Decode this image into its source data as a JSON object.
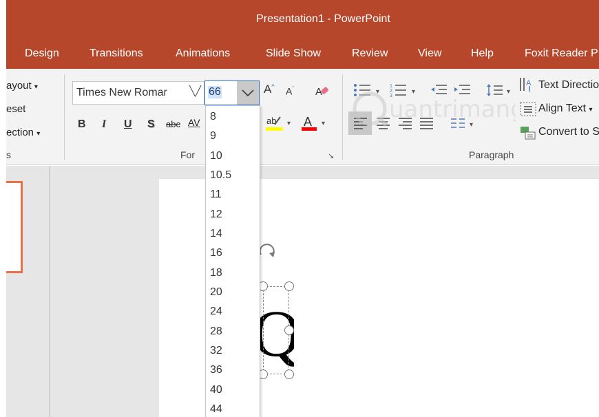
{
  "window": {
    "title": "Presentation1  -  PowerPoint"
  },
  "tabs": [
    {
      "label": "Design"
    },
    {
      "label": "Transitions"
    },
    {
      "label": "Animations"
    },
    {
      "label": "Slide Show"
    },
    {
      "label": "Review"
    },
    {
      "label": "View"
    },
    {
      "label": "Help"
    },
    {
      "label": "Foxit Reader P"
    }
  ],
  "slides_group": {
    "layout": "ayout",
    "reset": "eset",
    "section": "ection",
    "label": "s"
  },
  "font_group": {
    "font_name": "Times New Romar",
    "font_size": "66",
    "label": "For",
    "bold": "B",
    "italic": "I",
    "underline": "U",
    "shadow": "S",
    "strike": "abc",
    "spacing": "AV"
  },
  "paragraph_group": {
    "label": "Paragraph",
    "text_direction": "Text Directio",
    "align_text": "Align Text",
    "convert": "Convert to S"
  },
  "size_options": [
    "8",
    "9",
    "10",
    "10.5",
    "11",
    "12",
    "14",
    "16",
    "18",
    "20",
    "24",
    "28",
    "32",
    "36",
    "40",
    "44"
  ],
  "slide": {
    "glyph": "Q"
  },
  "colors": {
    "accent": "#b7472a",
    "highlight": "#ffff00",
    "font_color": "#ff0000",
    "thumb_border": "#ec7046"
  },
  "watermark": {
    "text": "uantrimang"
  }
}
